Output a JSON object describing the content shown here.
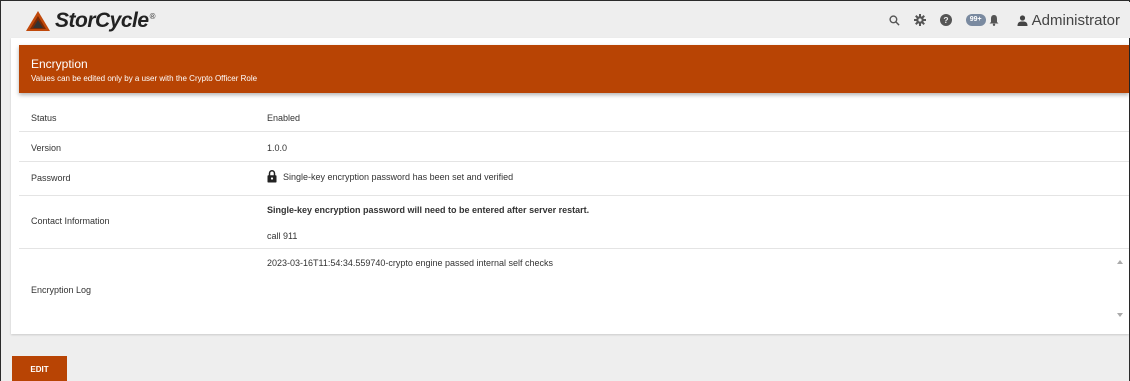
{
  "app": {
    "logo_text": "StorCycle",
    "logo_reg": "®"
  },
  "topbar": {
    "notification_badge": "99+",
    "user_label": "Administrator",
    "icons": [
      "search-icon",
      "gear-icon",
      "help-icon",
      "bell-icon",
      "user-icon"
    ]
  },
  "header": {
    "title": "Encryption",
    "subtitle": "Values can be edited only by a user with the Crypto Officer Role"
  },
  "rows": {
    "status": {
      "label": "Status",
      "value": "Enabled"
    },
    "version": {
      "label": "Version",
      "value": "1.0.0"
    },
    "password": {
      "label": "Password",
      "value": "Single-key encryption password has been set and verified",
      "icon": "lock-icon"
    },
    "contact": {
      "label": "Contact Information",
      "note": "Single-key encryption password will need to be entered after server restart.",
      "value": "call 911"
    },
    "log": {
      "label": "Encryption Log",
      "value": "2023-03-16T11:54:34.559740-crypto engine passed internal self checks"
    }
  },
  "actions": {
    "edit_label": "EDIT"
  },
  "colors": {
    "accent": "#b84404",
    "background": "#eeeeee",
    "card": "#ffffff",
    "badge": "#7a8aa0"
  }
}
